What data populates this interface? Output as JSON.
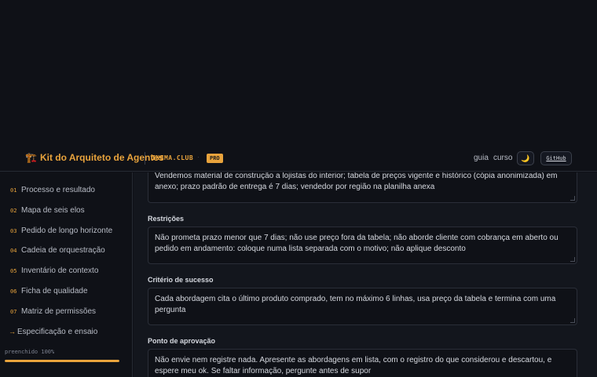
{
  "header": {
    "brand_icon": "🏗️",
    "brand_title": "Kit do Arquiteto de Agentes",
    "domain": "INEMA.CLUB",
    "domain_dot": "·",
    "badge": "PRO",
    "nav": {
      "guia": "guia",
      "curso": "curso"
    },
    "theme_icon": "🌙",
    "github": "GitHub"
  },
  "sidebar": {
    "items": [
      {
        "num": "01",
        "label": "Processo e resultado"
      },
      {
        "num": "02",
        "label": "Mapa de seis elos"
      },
      {
        "num": "03",
        "label": "Pedido de longo horizonte"
      },
      {
        "num": "04",
        "label": "Cadeia de orquestração"
      },
      {
        "num": "05",
        "label": "Inventário de contexto"
      },
      {
        "num": "06",
        "label": "Ficha de qualidade"
      },
      {
        "num": "07",
        "label": "Matriz de permissões"
      }
    ],
    "current": {
      "arrow": "→",
      "label": "Especificação e ensaio"
    },
    "progress_label": "preenchido 100%",
    "progress_value": 1.0
  },
  "main": {
    "context_value": "Vendemos material de construção a lojistas do interior; tabela de preços vigente e histórico (cópia anonimizada) em anexo; prazo padrão de entrega é 7 dias; vendedor por região na planilha anexa",
    "restricoes_label": "Restrições",
    "restricoes_value": "Não prometa prazo menor que 7 dias; não use preço fora da tabela; não aborde cliente com cobrança em aberto ou pedido em andamento: coloque numa lista separada com o motivo; não aplique desconto",
    "criterio_label": "Critério de sucesso",
    "criterio_value": "Cada abordagem cita o último produto comprado, tem no máximo 6 linhas, usa preço da tabela e termina com uma pergunta",
    "aprovacao_label": "Ponto de aprovação",
    "aprovacao_value": "Não envie nem registre nada. Apresente as abordagens em lista, com o registro do que considerou e descartou, e espere meu ok. Se faltar informação, pergunte antes de supor"
  },
  "colors": {
    "accent": "#e8a33c",
    "background": "#0f1117",
    "panel": "#13161d"
  }
}
